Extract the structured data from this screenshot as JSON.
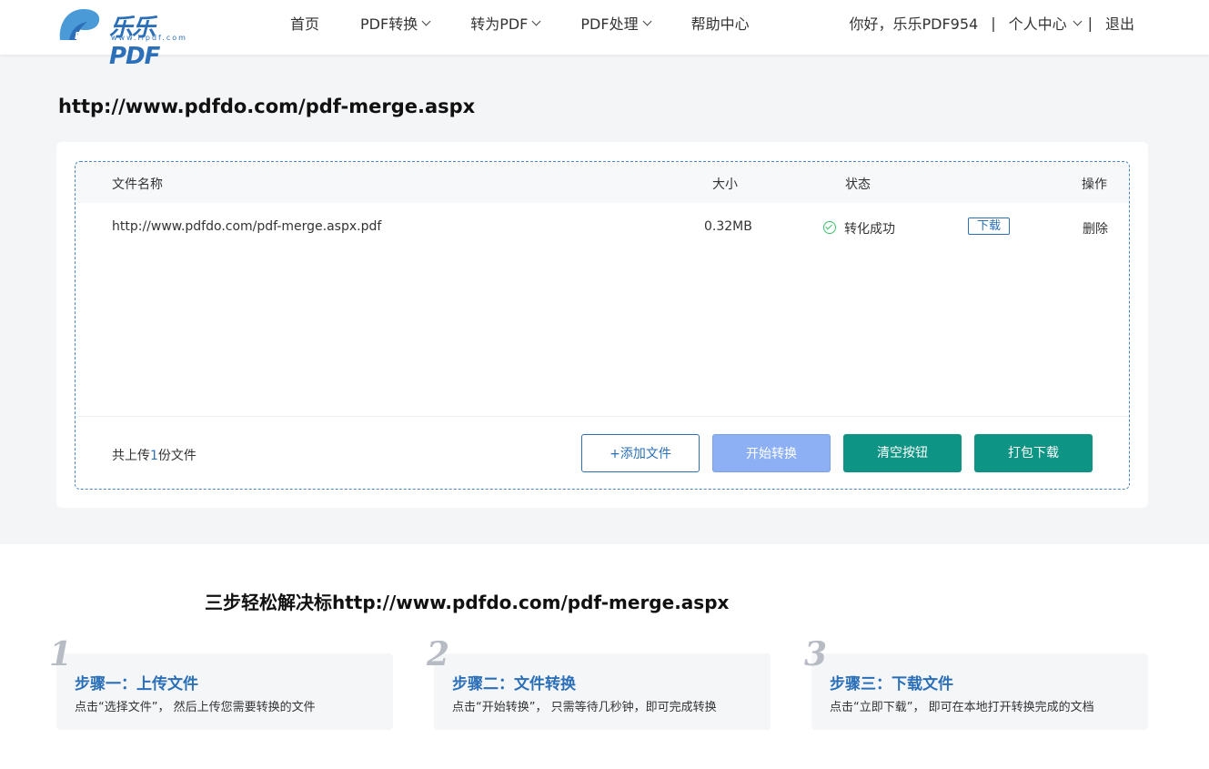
{
  "logo": {
    "text": "乐乐PDF",
    "subtitle": "www.llpdf.com",
    "mark": "PDF"
  },
  "nav": [
    {
      "label": "首页",
      "dropdown": false
    },
    {
      "label": "PDF转换",
      "dropdown": true
    },
    {
      "label": "转为PDF",
      "dropdown": true
    },
    {
      "label": "PDF处理",
      "dropdown": true
    },
    {
      "label": "帮助中心",
      "dropdown": false
    }
  ],
  "user": {
    "greeting": "你好，乐乐PDF954",
    "sep1": "|",
    "center": "个人中心",
    "sep2": "|",
    "logout": "退出"
  },
  "page_title": "http://www.pdfdo.com/pdf-merge.aspx",
  "table": {
    "headers": {
      "name": "文件名称",
      "size": "大小",
      "status": "状态",
      "action": "操作"
    },
    "rows": [
      {
        "name": "http://www.pdfdo.com/pdf-merge.aspx.pdf",
        "size": "0.32MB",
        "status": "转化成功",
        "download": "下载",
        "delete": "删除"
      }
    ]
  },
  "footer": {
    "prefix": "共上传",
    "count": "1",
    "suffix": "份文件"
  },
  "buttons": {
    "add": "+添加文件",
    "start": "开始转换",
    "clear": "清空按钮",
    "pack": "打包下载"
  },
  "steps_title": "三步轻松解决标http://www.pdfdo.com/pdf-merge.aspx",
  "steps": [
    {
      "num": "1",
      "title": "步骤一：上传文件",
      "desc": "点击“选择文件”， 然后上传您需要转换的文件"
    },
    {
      "num": "2",
      "title": "步骤二：文件转换",
      "desc": "点击“开始转换”， 只需等待几秒钟，即可完成转换"
    },
    {
      "num": "3",
      "title": "步骤三：下载文件",
      "desc": "点击“立即下载”， 即可在本地打开转换完成的文档"
    }
  ],
  "colors": {
    "accent": "#2a6fb8",
    "teal": "#0e9484",
    "light_blue": "#8db0f5",
    "success": "#3fbf6a"
  }
}
